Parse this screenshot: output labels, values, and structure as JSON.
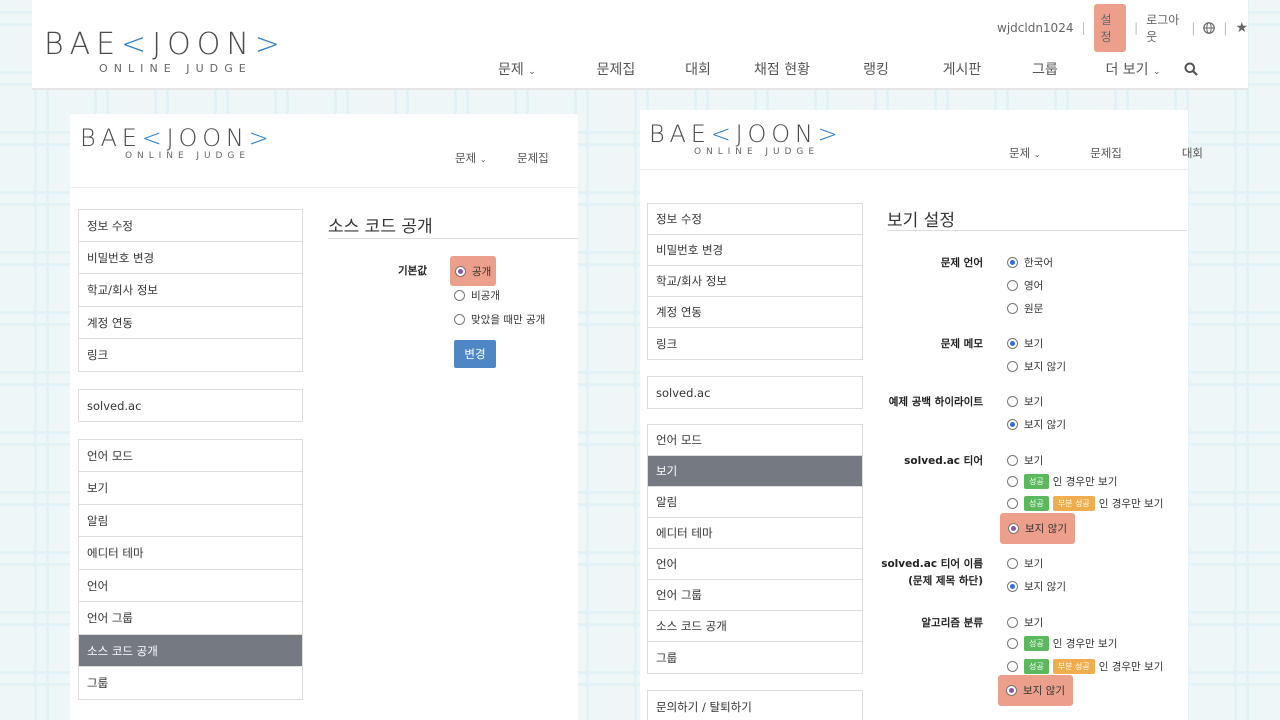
{
  "top": {
    "logo": {
      "part1": "BAE",
      "part2": "JOON",
      "sub": "ONLINE JUDGE"
    },
    "util": {
      "username": "wjdcldn1024",
      "settings": "설정",
      "logout": "로그아웃"
    },
    "nav": [
      "문제",
      "문제집",
      "대회",
      "채점 현황",
      "랭킹",
      "게시판",
      "그룹",
      "더 보기"
    ]
  },
  "left": {
    "nav": [
      "문제",
      "문제집"
    ],
    "menu_group1": [
      "정보 수정",
      "비밀번호 변경",
      "학교/회사 정보",
      "계정 연동",
      "링크"
    ],
    "menu_group2": [
      "solved.ac"
    ],
    "menu_group3": [
      "언어 모드",
      "보기",
      "알림",
      "에디터 테마",
      "언어",
      "언어 그룹",
      "소스 코드 공개",
      "그룹"
    ],
    "active_item": "소스 코드 공개",
    "section_title": "소스 코드 공개",
    "field_label": "기본값",
    "options": [
      "공개",
      "비공개",
      "맞았을 때만 공개"
    ],
    "selected": "공개",
    "submit": "변경"
  },
  "right": {
    "nav": [
      "문제",
      "문제집",
      "대회"
    ],
    "menu_group1": [
      "정보 수정",
      "비밀번호 변경",
      "학교/회사 정보",
      "계정 연동",
      "링크"
    ],
    "menu_group2": [
      "solved.ac"
    ],
    "menu_group3": [
      "언어 모드",
      "보기",
      "알림",
      "에디터 테마",
      "언어",
      "언어 그룹",
      "소스 코드 공개",
      "그룹"
    ],
    "menu_group4": [
      "문의하기 / 탈퇴하기"
    ],
    "active_item": "보기",
    "section_title": "보기 설정",
    "fields": {
      "lang_label": "문제 언어",
      "lang_opts": [
        "한국어",
        "영어",
        "원문"
      ],
      "memo_label": "문제 메모",
      "memo_opts": [
        "보기",
        "보지 않기"
      ],
      "space_label": "예제 공백 하이라이트",
      "space_opts": [
        "보기",
        "보지 않기"
      ],
      "tier_label": "solved.ac 티어",
      "tier_opts": [
        "보기",
        "인 경우만 보기",
        "인 경우만 보기",
        "보지 않기"
      ],
      "tiername_label1": "solved.ac 티어 이름",
      "tiername_label2": "(문제 제목 하단)",
      "tiername_opts": [
        "보기",
        "보지 않기"
      ],
      "algo_label": "알고리즘 분류",
      "algo_opts": [
        "보기",
        "인 경우만 보기",
        "인 경우만 보기",
        "보지 않기"
      ],
      "badge_success": "성공",
      "badge_partial": "부분 성공"
    }
  },
  "colors": {
    "accent": "#2d7ec4",
    "highlight": "#ec9f8b",
    "active_menu": "#757a82",
    "button": "#4f86c6"
  }
}
